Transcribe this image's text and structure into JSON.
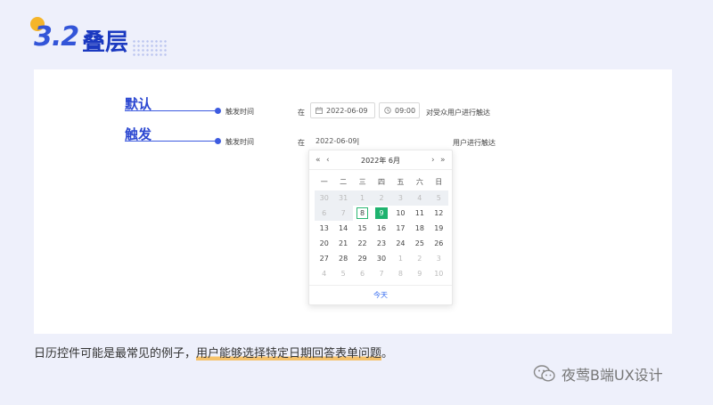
{
  "header": {
    "section_number": "3.2",
    "title": "叠层"
  },
  "rows": [
    {
      "label": "默认",
      "trigger_text": "触发时间"
    },
    {
      "label": "触发",
      "trigger_text": "触发时间"
    }
  ],
  "form_default": {
    "prefix": "在",
    "date_value": "2022-06-09",
    "time_value": "09:00",
    "suffix": "对受众用户进行触达",
    "date_icon": "calendar-icon",
    "time_icon": "clock-icon"
  },
  "form_trigger": {
    "prefix": "在",
    "date_input_value": "2022-06-09",
    "suffix_partial": "用户进行触达"
  },
  "calendar": {
    "prev_year": "«",
    "prev_month": "‹",
    "year_month": "2022年 6月",
    "next_month": "›",
    "next_year": "»",
    "weekdays": [
      "一",
      "二",
      "三",
      "四",
      "五",
      "六",
      "日"
    ],
    "days": [
      "30",
      "31",
      "1",
      "2",
      "3",
      "4",
      "5",
      "6",
      "7",
      "8",
      "9",
      "10",
      "11",
      "12",
      "13",
      "14",
      "15",
      "16",
      "17",
      "18",
      "19",
      "20",
      "21",
      "22",
      "23",
      "24",
      "25",
      "26",
      "27",
      "28",
      "29",
      "30",
      "1",
      "2",
      "3",
      "4",
      "5",
      "6",
      "7",
      "8",
      "9",
      "10"
    ],
    "today_label": "今天",
    "accent_color": "#1fb36f"
  },
  "caption": {
    "part1": "日历控件可能是最常见的例子，",
    "highlight": "用户能够选择特定日期回答表单问题",
    "part2": "。"
  },
  "watermark": {
    "text": "夜莺B端UX设计",
    "icon": "wechat-icon"
  }
}
